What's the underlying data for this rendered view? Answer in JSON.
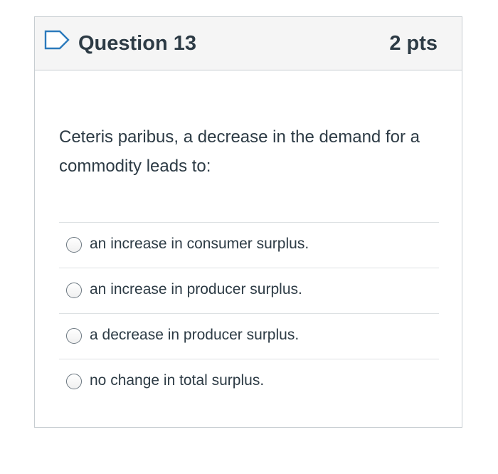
{
  "question": {
    "title": "Question 13",
    "points": "2 pts",
    "flag_icon": "flag-outline-icon",
    "text": "Ceteris paribus, a decrease in the demand for a commodity leads to:"
  },
  "answers": [
    {
      "label": "an increase in consumer surplus.",
      "selected": false
    },
    {
      "label": "an increase in producer surplus.",
      "selected": false
    },
    {
      "label": "a decrease in producer surplus.",
      "selected": false
    },
    {
      "label": "no change in total surplus.",
      "selected": false
    }
  ],
  "colors": {
    "text": "#2d3b45",
    "header_bg": "#f5f5f5",
    "border": "#c7cdd1",
    "flag": "#2b7abc",
    "divider": "#dde1e3"
  }
}
